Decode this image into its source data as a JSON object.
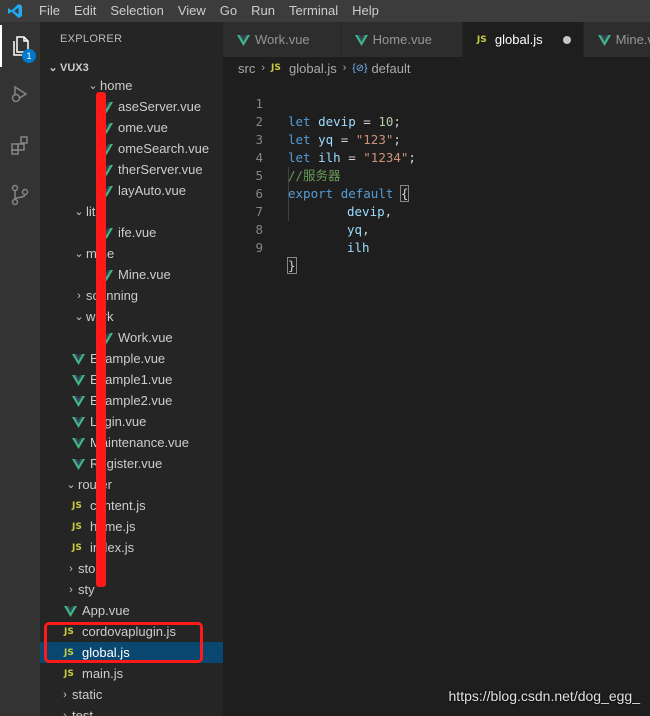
{
  "menu": [
    "File",
    "Edit",
    "Selection",
    "View",
    "Go",
    "Run",
    "Terminal",
    "Help"
  ],
  "activity": {
    "explorer_badge": "1"
  },
  "sidebar": {
    "title": "EXPLORER",
    "section": "VUX3",
    "rows": [
      {
        "label": "home",
        "type": "folder-open"
      },
      {
        "label": "aseServer.vue",
        "type": "vue"
      },
      {
        "label": "ome.vue",
        "type": "vue"
      },
      {
        "label": "omeSearch.vue",
        "type": "vue"
      },
      {
        "label": "therServer.vue",
        "type": "vue"
      },
      {
        "label": "layAuto.vue",
        "type": "vue"
      },
      {
        "label": "lit",
        "type": "folder-open"
      },
      {
        "label": "ife.vue",
        "type": "vue"
      },
      {
        "label": "mine",
        "type": "folder-open"
      },
      {
        "label": "Mine.vue",
        "type": "vue"
      },
      {
        "label": "scanning",
        "type": "folder-closed"
      },
      {
        "label": "work",
        "type": "folder-open"
      },
      {
        "label": "Work.vue",
        "type": "vue"
      },
      {
        "label": "Example.vue",
        "type": "vue"
      },
      {
        "label": "Example1.vue",
        "type": "vue"
      },
      {
        "label": "Example2.vue",
        "type": "vue"
      },
      {
        "label": "Login.vue",
        "type": "vue"
      },
      {
        "label": "Maintenance.vue",
        "type": "vue"
      },
      {
        "label": "Register.vue",
        "type": "vue"
      },
      {
        "label": "router",
        "type": "folder-open"
      },
      {
        "label": "content.js",
        "type": "js"
      },
      {
        "label": "home.js",
        "type": "js"
      },
      {
        "label": "index.js",
        "type": "js"
      },
      {
        "label": "sto",
        "type": "folder-closed"
      },
      {
        "label": "sty",
        "type": "folder-closed"
      },
      {
        "label": "App.vue",
        "type": "vue"
      },
      {
        "label": "cordovaplugin.js",
        "type": "js"
      },
      {
        "label": "global.js",
        "type": "js",
        "selected": true
      },
      {
        "label": "main.js",
        "type": "js"
      },
      {
        "label": "static",
        "type": "folder-closed"
      },
      {
        "label": "test",
        "type": "folder-closed"
      }
    ]
  },
  "tabs": [
    {
      "label": "Work.vue",
      "type": "vue"
    },
    {
      "label": "Home.vue",
      "type": "vue"
    },
    {
      "label": "global.js",
      "type": "js",
      "active": true,
      "modified": true
    },
    {
      "label": "Mine.vue",
      "type": "vue"
    }
  ],
  "breadcrumb": {
    "folder": "src",
    "file": "global.js",
    "symbol_icon": "{⊘}",
    "symbol": "default"
  },
  "editor": {
    "line_numbers": [
      "1",
      "2",
      "3",
      "4",
      "5",
      "6",
      "7",
      "8",
      "9"
    ],
    "tokens": {
      "let": "let",
      "var1": "devip",
      "eq": " = ",
      "val1": "10",
      "semi": ";",
      "var2": "yq",
      "val2": "\"123\"",
      "var3": "ilh",
      "val3": "\"1234\"",
      "comment": "//服务器",
      "export": "export",
      "default": "default",
      "open": "{",
      "prop1": "devip",
      "prop2": "yq",
      "prop3": "ilh",
      "comma": ",",
      "close": "}"
    }
  },
  "watermark": "https://blog.csdn.net/dog_egg_",
  "colors": {
    "accent": "#007acc",
    "annotation": "#ff1a1a",
    "vue_green": "#41b883",
    "js_yellow": "#cbcb41"
  }
}
